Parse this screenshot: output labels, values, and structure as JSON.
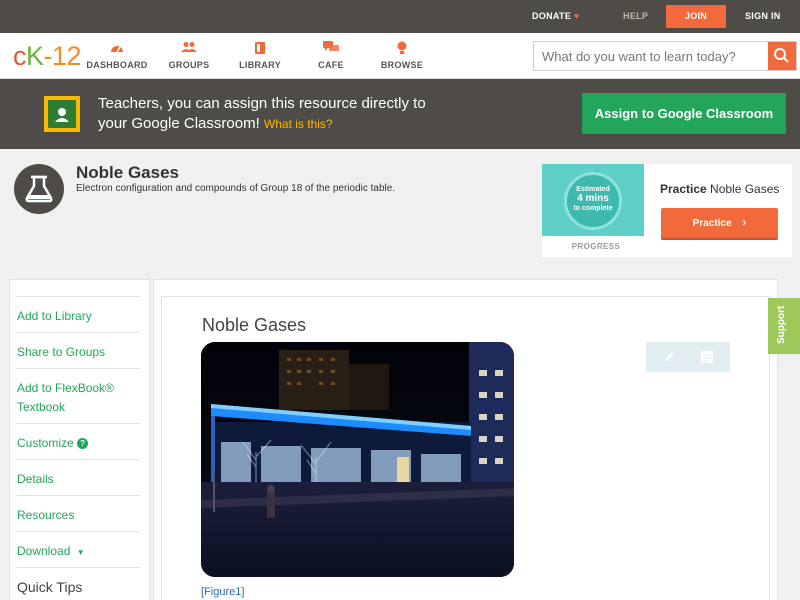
{
  "topbar": {
    "donate": "DONATE",
    "help": "HELP",
    "join": "JOIN",
    "signin": "SIGN IN"
  },
  "logo": {
    "c": "c",
    "k": "K",
    "dash": "-",
    "num": "12"
  },
  "nav": {
    "dashboard": "DASHBOARD",
    "groups": "GROUPS",
    "library": "LIBRARY",
    "cafe": "CAFE",
    "browse": "BROWSE"
  },
  "search": {
    "placeholder": "What do you want to learn today?"
  },
  "banner": {
    "line1": "Teachers, you can assign this resource directly to",
    "line2": "your Google Classroom! ",
    "what": "What is this?",
    "button": "Assign to Google Classroom"
  },
  "concept": {
    "title": "Noble Gases",
    "description": "Electron configuration and compounds of Group 18 of the periodic table."
  },
  "practice": {
    "estimated": "Estimated",
    "mins": "4 mins",
    "complete": "to complete",
    "progress_label": "PROGRESS",
    "title_bold": "Practice",
    "title_rest": " Noble Gases",
    "button": "Practice"
  },
  "sidebar": {
    "items": [
      {
        "label": "Add to Library"
      },
      {
        "label": "Share to Groups"
      },
      {
        "label": "Add to FlexBook® Textbook"
      },
      {
        "label": "Customize"
      },
      {
        "label": "Details"
      },
      {
        "label": "Resources"
      },
      {
        "label": "Download"
      },
      {
        "label": "Quick Tips"
      }
    ]
  },
  "article": {
    "title": "Noble Gases",
    "caption": "[Figure1]"
  },
  "support": "Support",
  "colors": {
    "accent": "#f26a3c",
    "green": "#23a55a",
    "dark": "#4f4c48"
  },
  "icons": [
    "heart-icon",
    "dashboard-icon",
    "groups-icon",
    "library-icon",
    "cafe-icon",
    "browse-icon",
    "search-icon",
    "google-classroom-icon",
    "chemistry-flask-icon",
    "chevron-right-icon",
    "help-circle-icon",
    "caret-down-icon",
    "pencil-icon",
    "notes-icon"
  ]
}
